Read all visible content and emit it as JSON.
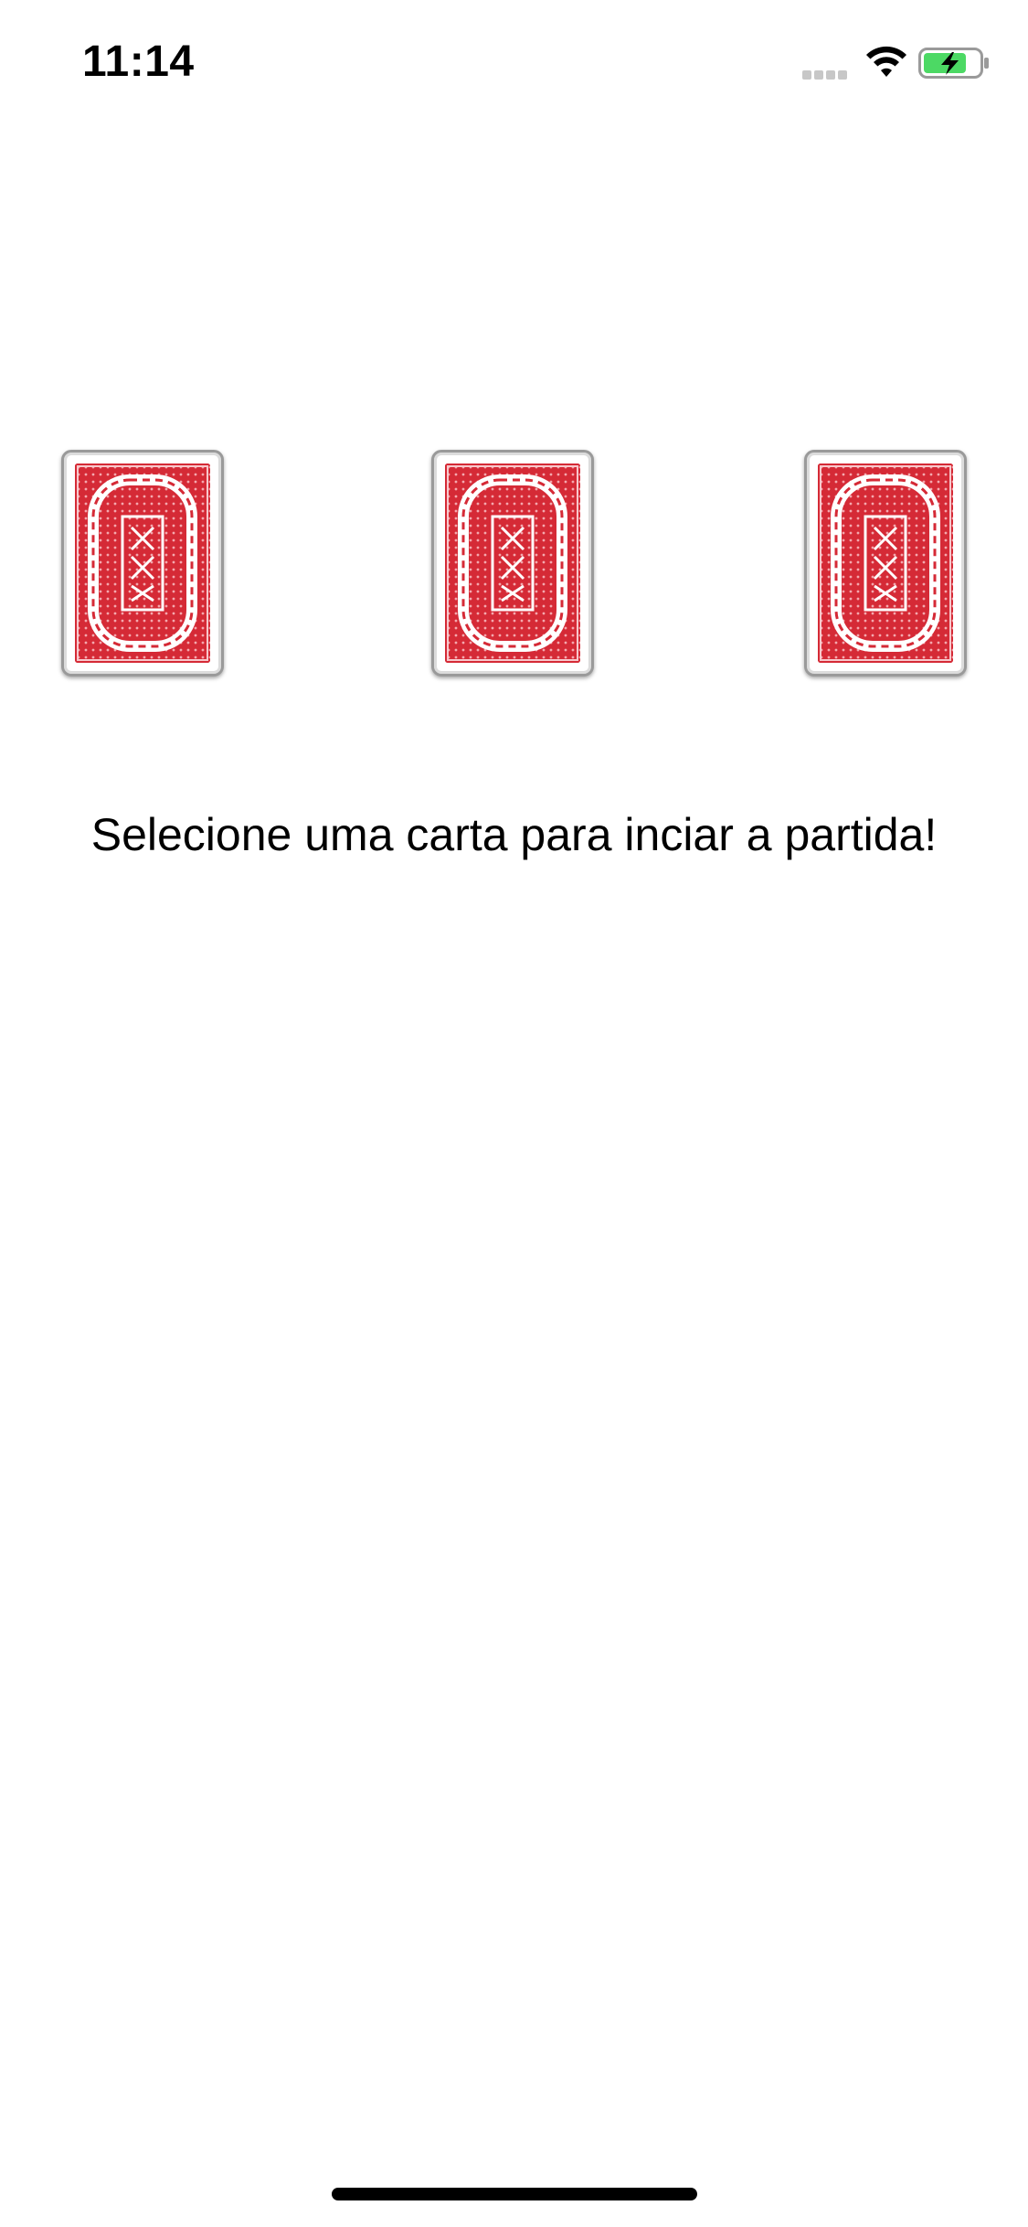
{
  "status_bar": {
    "time": "11:14",
    "signal_icon": "cellular-signal-icon",
    "wifi_icon": "wifi-icon",
    "battery_icon": "battery-charging-icon",
    "battery_color": "#4cd964"
  },
  "cards": [
    {
      "label": "card-back-left",
      "face": "red-card-back"
    },
    {
      "label": "card-back-middle",
      "face": "red-card-back"
    },
    {
      "label": "card-back-right",
      "face": "red-card-back"
    }
  ],
  "card_back_color": "#d52a36",
  "instruction": "Selecione uma carta para inciar a partida!"
}
